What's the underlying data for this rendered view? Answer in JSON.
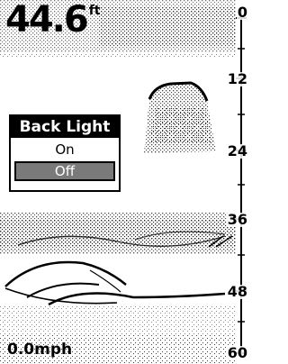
{
  "depth": {
    "value": "44.6",
    "unit": "ft"
  },
  "depth_scale": {
    "ticks": [
      "0",
      "12",
      "24",
      "36",
      "48",
      "60"
    ]
  },
  "speed": {
    "label": "0.0mph"
  },
  "menu": {
    "title": "Back Light",
    "options": [
      "On",
      "Off"
    ],
    "selected": "Off"
  },
  "colors": {
    "screen": "#ffffff",
    "ink": "#000000",
    "highlight": "#7a7a7a"
  }
}
